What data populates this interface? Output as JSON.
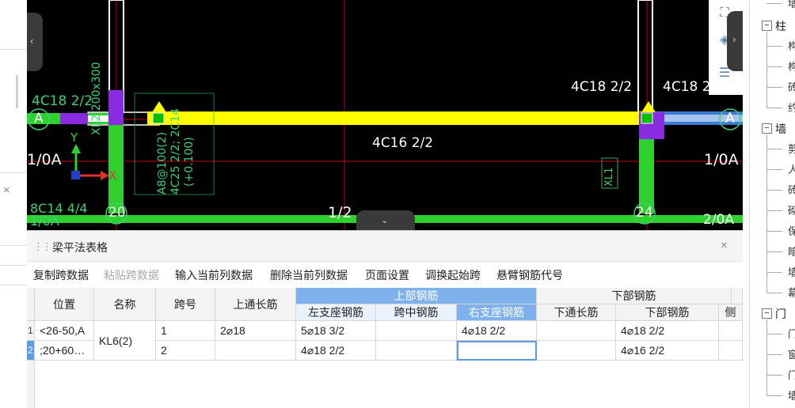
{
  "canvas": {
    "axis_a_left": "A",
    "axis_a_right": "A",
    "axis_10a_left": "1/0A",
    "axis_10a_right": "1/0A",
    "axis_20": "20",
    "axis_24": "24",
    "axis_12": "1/2",
    "axis_20a": "2/0A",
    "left_top_rebar": "4C18 2/2",
    "left_bottom_rebar": "8C14 4/4",
    "left_bottom_axis": "1/0A",
    "right_top_rebar_1": "4C18 2/2",
    "right_top_rebar_2": "4C18 2",
    "mid_bottom_rebar": "4C16 2/2",
    "vertical_label_1": "XL2 200x300",
    "vertical_label_2": "A8@100(2)",
    "vertical_label_3": "4C25 2/2; 2C14",
    "vertical_label_4": "(+0.100)",
    "vertical_label_xl": "XL1",
    "ucs_y": "Y",
    "ucs_x": "X"
  },
  "panel": {
    "title": "梁平法表格",
    "close": "×",
    "toolbar": [
      {
        "label": "复制跨数据",
        "enabled": true
      },
      {
        "label": "粘贴跨数据",
        "enabled": false
      },
      {
        "label": "输入当前列数据",
        "enabled": true
      },
      {
        "label": "删除当前列数据",
        "enabled": true
      },
      {
        "label": "页面设置",
        "enabled": true
      },
      {
        "label": "调换起始跨",
        "enabled": true
      },
      {
        "label": "悬臂钢筋代号",
        "enabled": true
      }
    ],
    "table": {
      "headers": {
        "position": "位置",
        "name": "名称",
        "span": "跨号",
        "top_through": "上通长筋",
        "top_group": "上部钢筋",
        "left_support": "左支座钢筋",
        "mid_span": "跨中钢筋",
        "right_support": "右支座钢筋",
        "bottom_group": "下部钢筋",
        "bottom_through": "下通长筋",
        "bottom_rebar": "下部钢筋",
        "side": "侧"
      },
      "rows": [
        {
          "num": "1",
          "position": "<26-50,A",
          "name": "KL6(2)",
          "span": "1",
          "top_through": "2⌀18",
          "left_support": "5⌀18 3/2",
          "mid_span": "",
          "right_support": "4⌀18 2/2",
          "bottom_through": "",
          "bottom_rebar": "4⌀18 2/2"
        },
        {
          "num": "2",
          "position": ";20+60…",
          "name": "",
          "span": "2",
          "top_through": "",
          "left_support": "4⌀18 2/2",
          "mid_span": "",
          "right_support": "",
          "bottom_through": "",
          "bottom_rebar": "4⌀16 2/2"
        }
      ]
    }
  },
  "tree": {
    "groups": [
      {
        "label": "柱",
        "children": [
          "构",
          "构",
          "砖",
          "约"
        ]
      },
      {
        "label": "墙",
        "children": [
          "剪",
          "人",
          "砖",
          "砌",
          "保",
          "暗",
          "墙",
          "幕"
        ]
      },
      {
        "label": "门",
        "children": [
          "门",
          "窗",
          "门",
          "墙"
        ]
      }
    ],
    "top_partial": "墙"
  },
  "colors": {
    "beam_yellow": "#ffff00",
    "column_green": "#2fd12f",
    "wall_purple": "#8a2be2",
    "axis_red": "#cc0000",
    "beam_blue": "#3a7bd5",
    "header_blue": "#7fb1ec"
  }
}
